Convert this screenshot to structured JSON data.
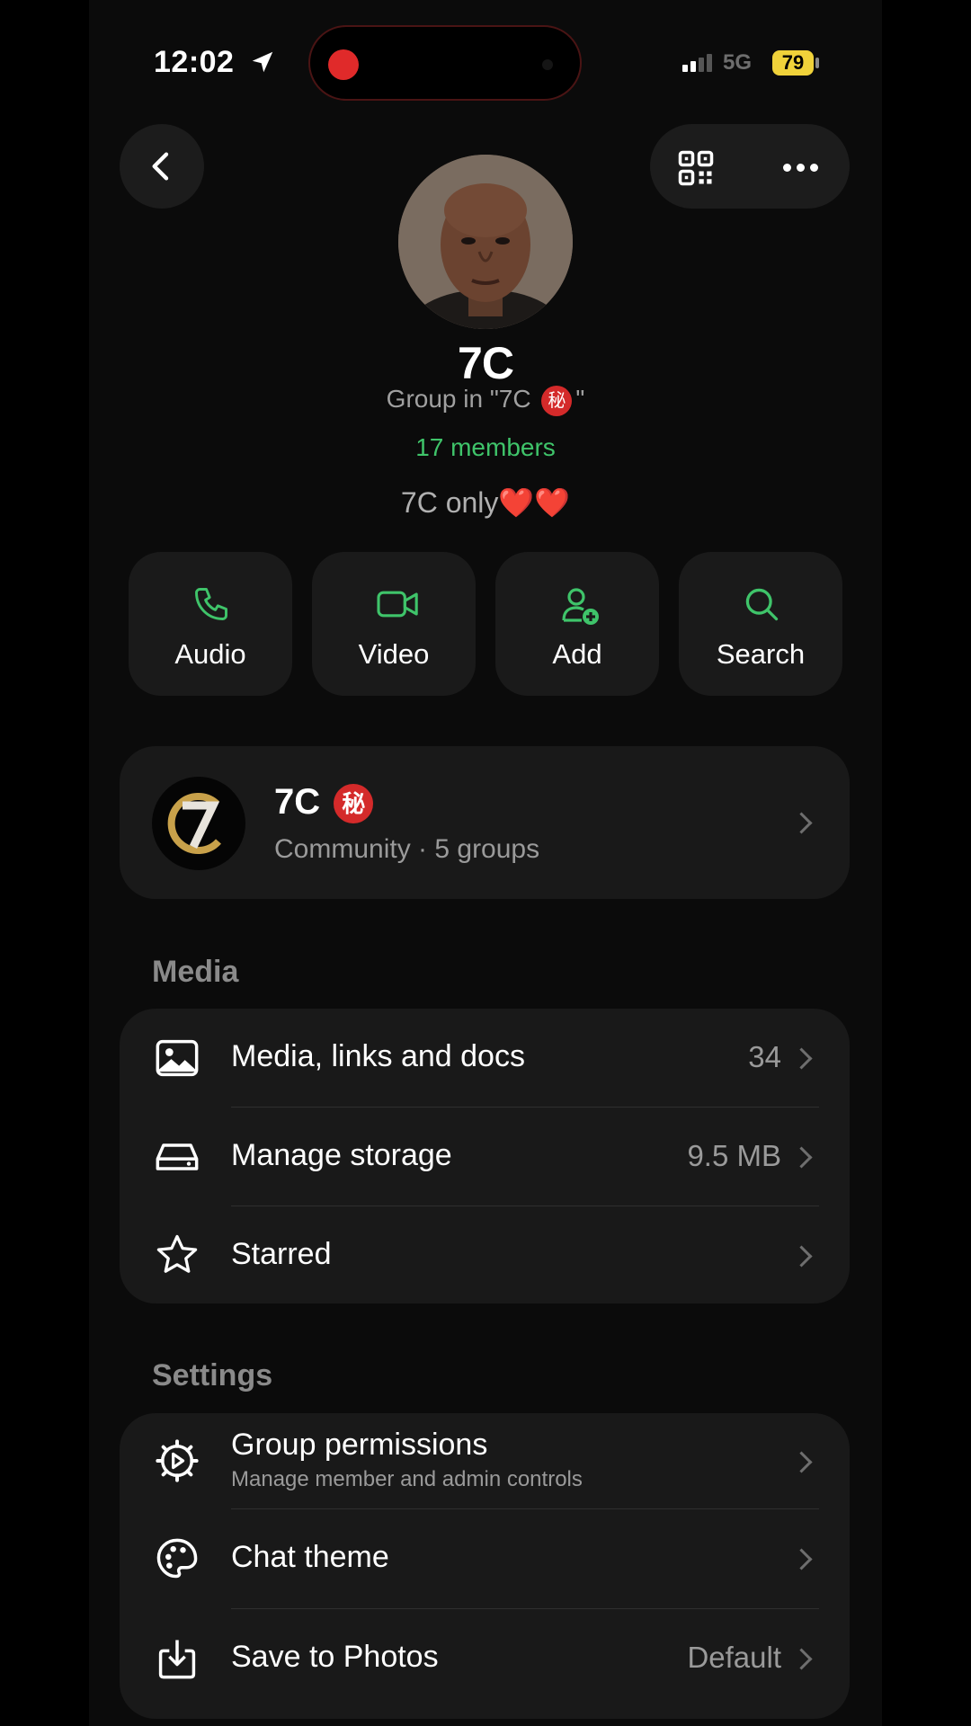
{
  "status": {
    "time": "12:02",
    "network": "5G",
    "battery": "79"
  },
  "group": {
    "name": "7C",
    "subtitle_prefix": "Group in \"7C",
    "subtitle_suffix": "\"",
    "secret_badge": "秘",
    "members": "17 members",
    "description": "7C only",
    "hearts": "❤️❤️"
  },
  "actions": [
    {
      "label": "Audio",
      "icon": "phone-icon"
    },
    {
      "label": "Video",
      "icon": "video-icon"
    },
    {
      "label": "Add",
      "icon": "add-person-icon"
    },
    {
      "label": "Search",
      "icon": "search-icon"
    }
  ],
  "community": {
    "name": "7C",
    "badge": "秘",
    "subtitle": "Community · 5 groups"
  },
  "media": {
    "section_label": "Media",
    "items": [
      {
        "label": "Media, links and docs",
        "value": "34",
        "icon": "image-icon"
      },
      {
        "label": "Manage storage",
        "value": "9.5 MB",
        "icon": "storage-icon"
      },
      {
        "label": "Starred",
        "value": "",
        "icon": "star-icon"
      }
    ]
  },
  "settings": {
    "section_label": "Settings",
    "items": [
      {
        "label": "Group permissions",
        "sublabel": "Manage member and admin controls",
        "value": "",
        "icon": "gear-icon"
      },
      {
        "label": "Chat theme",
        "value": "",
        "icon": "palette-icon"
      },
      {
        "label": "Save to Photos",
        "value": "Default",
        "icon": "download-icon"
      }
    ]
  },
  "colors": {
    "accent": "#3fc46a",
    "background": "#0b0b0b",
    "card": "#191919"
  }
}
